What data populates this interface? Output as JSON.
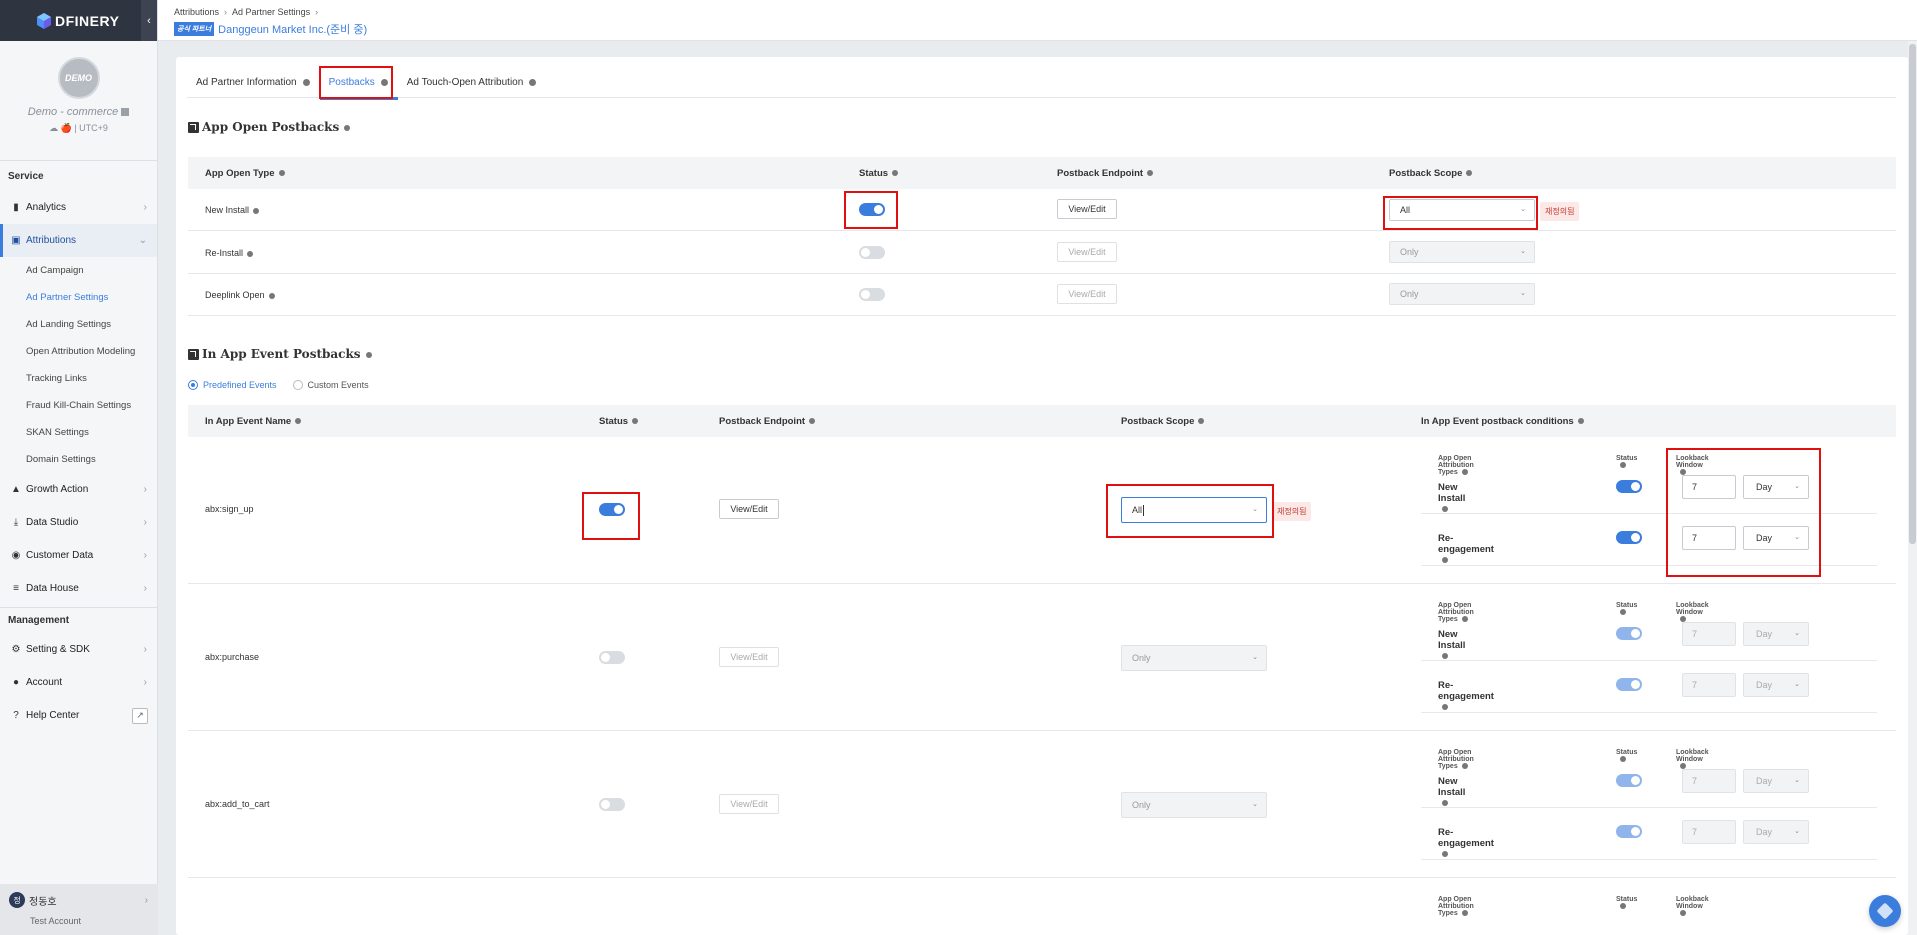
{
  "brand": {
    "name": "DFINERY"
  },
  "profile": {
    "avatar_text": "DEMO",
    "app_name": "Demo - commerce",
    "meta": "☁ 🍎 | UTC+9"
  },
  "nav": {
    "service_label": "Service",
    "management_label": "Management",
    "analytics": "Analytics",
    "attributions": "Attributions",
    "attribution_subitems": [
      "Ad Campaign",
      "Ad Partner Settings",
      "Ad Landing Settings",
      "Open Attribution Modeling",
      "Tracking Links",
      "Fraud Kill-Chain Settings",
      "SKAN Settings",
      "Domain Settings"
    ],
    "growth_action": "Growth Action",
    "data_studio": "Data Studio",
    "customer_data": "Customer Data",
    "data_house": "Data House",
    "setting_sdk": "Setting & SDK",
    "account": "Account",
    "help_center": "Help Center"
  },
  "user": {
    "initial": "정",
    "name": "정동호",
    "subtitle": "Test Account"
  },
  "header": {
    "breadcrumb": [
      "Attributions",
      "Ad Partner Settings"
    ],
    "badge": "공식 파트너",
    "title": "Danggeun Market Inc.(준비 중)"
  },
  "tabs": [
    "Ad Partner Information",
    "Postbacks",
    "Ad Touch-Open Attribution"
  ],
  "app_open": {
    "title": "App Open Postbacks",
    "columns": {
      "type": "App Open Type",
      "status": "Status",
      "endpoint": "Postback Endpoint",
      "scope": "Postback Scope"
    },
    "rows": [
      {
        "type": "New Install",
        "status": true,
        "endpoint": "View/Edit",
        "scope": "All",
        "warn": "재정의됨"
      },
      {
        "type": "Re-Install",
        "status": false,
        "endpoint": "View/Edit",
        "scope": "Only"
      },
      {
        "type": "Deeplink Open",
        "status": false,
        "endpoint": "View/Edit",
        "scope": "Only"
      }
    ]
  },
  "in_app": {
    "title": "In App Event Postbacks",
    "radio_predefined": "Predefined Events",
    "radio_custom": "Custom Events",
    "columns": {
      "name": "In App Event Name",
      "status": "Status",
      "endpoint": "Postback Endpoint",
      "scope": "Postback Scope",
      "conditions": "In App Event postback conditions"
    },
    "cond_headers": {
      "types": "App Open Attribution Types",
      "status": "Status",
      "lookback": "Lookback Window"
    },
    "cond_labels": {
      "new_install": "New Install",
      "reengagement": "Re-engagement"
    },
    "lookback_value": "7",
    "lookback_unit": "Day",
    "rows": [
      {
        "name": "abx:sign_up",
        "status": true,
        "endpoint": "View/Edit",
        "scope": "All",
        "warn": "재정의됨"
      },
      {
        "name": "abx:purchase",
        "status": false,
        "endpoint": "View/Edit",
        "scope": "Only"
      },
      {
        "name": "abx:add_to_cart",
        "status": false,
        "endpoint": "View/Edit",
        "scope": "Only"
      }
    ]
  },
  "colors": {
    "accent": "#3b7ddd",
    "highlight_box": "#e01010",
    "sidebar_dark": "#2e3440"
  }
}
